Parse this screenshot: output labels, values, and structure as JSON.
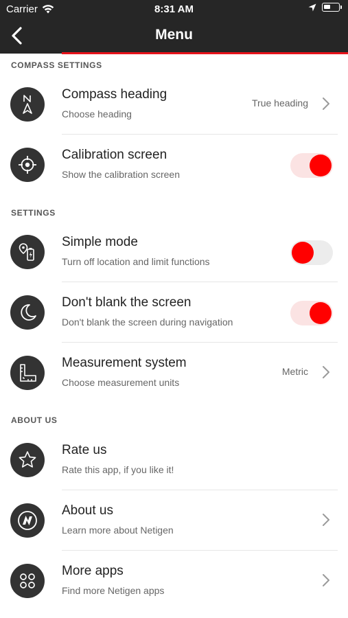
{
  "status_bar": {
    "carrier": "Carrier",
    "time": "8:31 AM"
  },
  "nav": {
    "title": "Menu",
    "accent_color": "#e8141b"
  },
  "sections": {
    "compass": "COMPASS SETTINGS",
    "settings": "SETTINGS",
    "about": "ABOUT US"
  },
  "rows": {
    "compass_heading": {
      "title": "Compass heading",
      "subtitle": "Choose heading",
      "value": "True heading",
      "icon": "compass-north-icon"
    },
    "calibration": {
      "title": "Calibration screen",
      "subtitle": "Show the calibration screen",
      "toggle": "on",
      "icon": "crosshair-icon"
    },
    "simple_mode": {
      "title": "Simple mode",
      "subtitle": "Turn off location and limit functions",
      "toggle": "off",
      "icon": "location-battery-icon"
    },
    "dont_blank": {
      "title": "Don't blank the screen",
      "subtitle": "Don't blank the screen during navigation",
      "toggle": "on",
      "icon": "moon-icon"
    },
    "measurement": {
      "title": "Measurement system",
      "subtitle": "Choose measurement units",
      "value": "Metric",
      "icon": "ruler-icon"
    },
    "rate_us": {
      "title": "Rate us",
      "subtitle": "Rate this app, if you like it!",
      "icon": "star-icon"
    },
    "about_us": {
      "title": "About us",
      "subtitle": "Learn more about Netigen",
      "icon": "netigen-logo-icon"
    },
    "more_apps": {
      "title": "More apps",
      "subtitle": "Find more Netigen apps",
      "icon": "apps-grid-icon"
    }
  },
  "colors": {
    "toggle_knob": "#ff0000",
    "toggle_track_on": "#fbe3e3",
    "toggle_track_off": "#ececec",
    "icon_bg": "#333333",
    "bar_bg": "#262626"
  }
}
